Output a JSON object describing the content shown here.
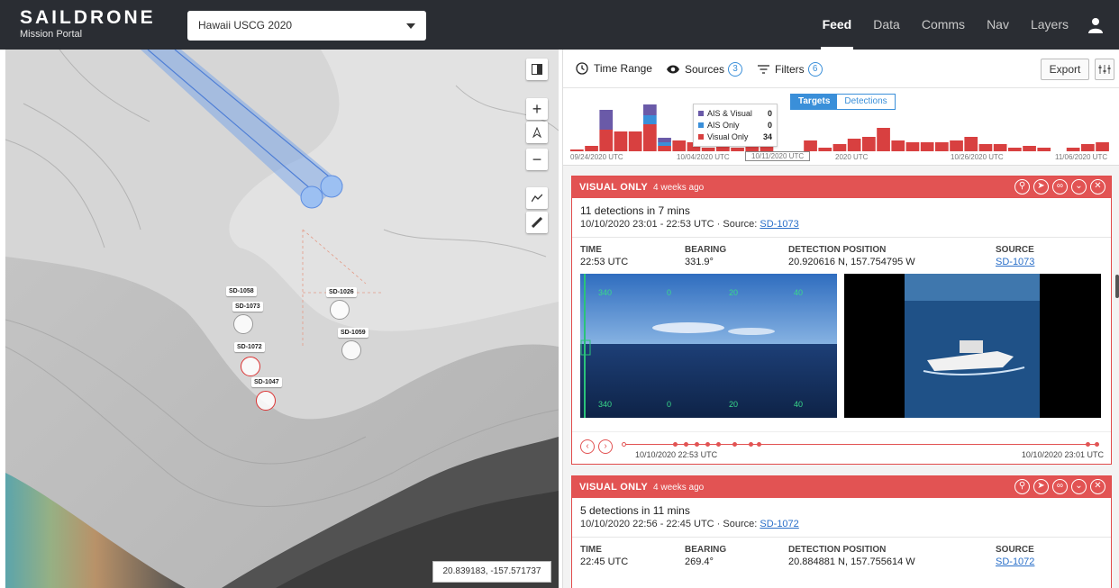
{
  "app": {
    "brand": "SAILDRONE",
    "subtitle": "Mission Portal",
    "mission": "Hawaii USCG 2020"
  },
  "nav": {
    "items": [
      "Feed",
      "Data",
      "Comms",
      "Nav",
      "Layers"
    ],
    "active": "Feed"
  },
  "map": {
    "coordinates": "20.839183, -157.571737",
    "drones": [
      {
        "label": "SD-1058"
      },
      {
        "label": "SD-1073"
      },
      {
        "label": "SD-1026"
      },
      {
        "label": "SD-1059"
      },
      {
        "label": "SD-1072"
      },
      {
        "label": "SD-1047"
      }
    ]
  },
  "toolbar": {
    "time_range": "Time Range",
    "sources": "Sources",
    "sources_count": "3",
    "filters": "Filters",
    "filters_count": "6",
    "export": "Export"
  },
  "histogram": {
    "toggle": {
      "targets": "Targets",
      "detections": "Detections"
    },
    "legend": [
      {
        "label": "AIS & Visual",
        "value": "0",
        "color": "#6a5aa8"
      },
      {
        "label": "AIS Only",
        "value": "0",
        "color": "#3a8fd9"
      },
      {
        "label": "Visual Only",
        "value": "34",
        "color": "#d84040"
      }
    ],
    "ticks": [
      "09/24/2020 UTC",
      "10/04/2020 UTC",
      "10/11/2020 UTC",
      "2020 UTC",
      "10/26/2020 UTC",
      "11/06/2020 UTC"
    ],
    "bars": [
      {
        "r": 2,
        "b": 0,
        "p": 0
      },
      {
        "r": 6,
        "b": 0,
        "p": 0
      },
      {
        "r": 24,
        "b": 0,
        "p": 22
      },
      {
        "r": 22,
        "b": 0,
        "p": 0
      },
      {
        "r": 22,
        "b": 0,
        "p": 0
      },
      {
        "r": 30,
        "b": 10,
        "p": 12
      },
      {
        "r": 6,
        "b": 4,
        "p": 5
      },
      {
        "r": 12,
        "b": 0,
        "p": 0
      },
      {
        "r": 10,
        "b": 0,
        "p": 0
      },
      {
        "r": 4,
        "b": 0,
        "p": 0
      },
      {
        "r": 8,
        "b": 0,
        "p": 6
      },
      {
        "r": 4,
        "b": 0,
        "p": 0
      },
      {
        "r": 10,
        "b": 0,
        "p": 0
      },
      {
        "r": 14,
        "b": 0,
        "p": 0
      },
      {
        "r": 0,
        "b": 0,
        "p": 0
      },
      {
        "r": 0,
        "b": 0,
        "p": 0
      },
      {
        "r": 12,
        "b": 0,
        "p": 0
      },
      {
        "r": 4,
        "b": 0,
        "p": 0
      },
      {
        "r": 8,
        "b": 0,
        "p": 0
      },
      {
        "r": 14,
        "b": 0,
        "p": 0
      },
      {
        "r": 16,
        "b": 0,
        "p": 0
      },
      {
        "r": 26,
        "b": 0,
        "p": 0
      },
      {
        "r": 12,
        "b": 0,
        "p": 0
      },
      {
        "r": 10,
        "b": 0,
        "p": 0
      },
      {
        "r": 10,
        "b": 0,
        "p": 0
      },
      {
        "r": 10,
        "b": 0,
        "p": 0
      },
      {
        "r": 12,
        "b": 0,
        "p": 0
      },
      {
        "r": 16,
        "b": 0,
        "p": 0
      },
      {
        "r": 8,
        "b": 0,
        "p": 0
      },
      {
        "r": 8,
        "b": 0,
        "p": 0
      },
      {
        "r": 4,
        "b": 0,
        "p": 0
      },
      {
        "r": 6,
        "b": 0,
        "p": 0
      },
      {
        "r": 4,
        "b": 0,
        "p": 0
      },
      {
        "r": 0,
        "b": 0,
        "p": 0
      },
      {
        "r": 4,
        "b": 0,
        "p": 0
      },
      {
        "r": 8,
        "b": 0,
        "p": 0
      },
      {
        "r": 10,
        "b": 0,
        "p": 0
      }
    ]
  },
  "cards": [
    {
      "type": "VISUAL ONLY",
      "ago": "4 weeks ago",
      "summary": "11 detections in 7 mins",
      "range": "10/10/2020 23:01 - 22:53 UTC",
      "source_prefix": "Source:",
      "source": "SD-1073",
      "time_label": "TIME",
      "time": "22:53 UTC",
      "bearing_label": "BEARING",
      "bearing": "331.9°",
      "position_label": "DETECTION POSITION",
      "position": "20.920616 N, 157.754795 W",
      "source_label": "SOURCE",
      "timeline_start": "10/10/2020 22:53 UTC",
      "timeline_end": "10/10/2020 23:01 UTC",
      "compass": [
        "340",
        "0",
        "20",
        "40"
      ]
    },
    {
      "type": "VISUAL ONLY",
      "ago": "4 weeks ago",
      "summary": "5 detections in 11 mins",
      "range": "10/10/2020 22:56 - 22:45 UTC",
      "source_prefix": "Source:",
      "source": "SD-1072",
      "time_label": "TIME",
      "time": "22:45 UTC",
      "bearing_label": "BEARING",
      "bearing": "269.4°",
      "position_label": "DETECTION POSITION",
      "position": "20.884881 N, 157.755614 W",
      "source_label": "SOURCE"
    }
  ]
}
